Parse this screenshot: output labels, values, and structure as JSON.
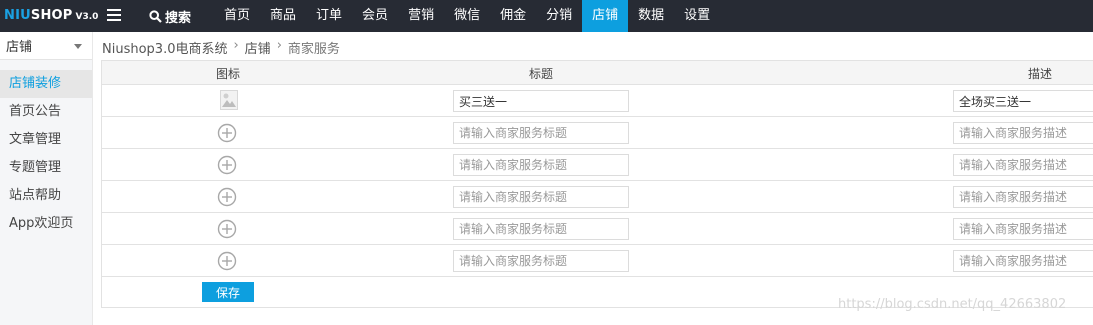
{
  "brand": {
    "name_prefix": "NIU",
    "name_suffix": "SHOP",
    "version": "V3.0"
  },
  "search": {
    "label": "搜索",
    "icon": "search-icon"
  },
  "nav": {
    "items": [
      {
        "label": "首页",
        "active": false
      },
      {
        "label": "商品",
        "active": false
      },
      {
        "label": "订单",
        "active": false
      },
      {
        "label": "会员",
        "active": false
      },
      {
        "label": "营销",
        "active": false
      },
      {
        "label": "微信",
        "active": false
      },
      {
        "label": "佣金",
        "active": false
      },
      {
        "label": "分销",
        "active": false
      },
      {
        "label": "店铺",
        "active": true
      },
      {
        "label": "数据",
        "active": false
      },
      {
        "label": "设置",
        "active": false
      }
    ]
  },
  "sidebar": {
    "select_label": "店铺",
    "items": [
      {
        "label": "店铺装修",
        "active": true
      },
      {
        "label": "首页公告",
        "active": false
      },
      {
        "label": "文章管理",
        "active": false
      },
      {
        "label": "专题管理",
        "active": false
      },
      {
        "label": "站点帮助",
        "active": false
      },
      {
        "label": "App欢迎页",
        "active": false
      }
    ]
  },
  "breadcrumb": {
    "root": "Niushop3.0电商系统",
    "middle": "店铺",
    "current": "商家服务"
  },
  "table": {
    "headers": {
      "icon": "图标",
      "title": "标题",
      "desc": "描述"
    },
    "title_placeholder": "请输入商家服务标题",
    "desc_placeholder": "请输入商家服务描述",
    "rows": [
      {
        "icon": "image-thumbnail",
        "title": "买三送一",
        "desc": "全场买三送一"
      },
      {
        "icon": "plus-circle-icon",
        "title": "",
        "desc": ""
      },
      {
        "icon": "plus-circle-icon",
        "title": "",
        "desc": ""
      },
      {
        "icon": "plus-circle-icon",
        "title": "",
        "desc": ""
      },
      {
        "icon": "plus-circle-icon",
        "title": "",
        "desc": ""
      },
      {
        "icon": "plus-circle-icon",
        "title": "",
        "desc": ""
      }
    ],
    "save_label": "保存"
  },
  "watermark": "https://blog.csdn.net/qq_42663802",
  "colors": {
    "topbar": "#272b34",
    "accent": "#0d9fdf"
  }
}
